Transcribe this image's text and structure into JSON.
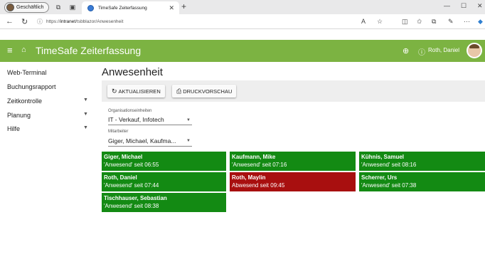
{
  "browser": {
    "profile_label": "Geschäftlich",
    "tab_title": "TimeSafe Zeiterfassung",
    "url_prefix": "https://",
    "url_host": "intranet",
    "url_path": "/tsbblazor/Anwesenheit"
  },
  "app": {
    "title": "TimeSafe Zeiterfassung",
    "user_name": "Roth, Daniel",
    "header_color": "#7cb342"
  },
  "sidebar": {
    "items": [
      {
        "label": "Web-Terminal",
        "has_children": false
      },
      {
        "label": "Buchungsrapport",
        "has_children": false
      },
      {
        "label": "Zeitkontrolle",
        "has_children": true
      },
      {
        "label": "Planung",
        "has_children": true
      },
      {
        "label": "Hilfe",
        "has_children": true
      }
    ]
  },
  "page": {
    "title": "Anwesenheit",
    "refresh_label": "AKTUALISIEREN",
    "print_label": "DRUCKVORSCHAU",
    "org_label": "Organisationseinheiten",
    "org_value": "IT - Verkauf, Infotech",
    "staff_label": "Mitarbeiter",
    "staff_value": "Giger, Michael, Kaufma..."
  },
  "colors": {
    "present": "#138a13",
    "absent": "#a80f0f"
  },
  "employees": [
    {
      "name": "Giger, Michael",
      "status": "'Anwesend' seit 06:55",
      "state": "present"
    },
    {
      "name": "Kaufmann, Mike",
      "status": "'Anwesend' seit 07:16",
      "state": "present"
    },
    {
      "name": "Kühnis, Samuel",
      "status": "'Anwesend' seit 08:16",
      "state": "present"
    },
    {
      "name": "Roth, Daniel",
      "status": "'Anwesend' seit 07:44",
      "state": "present"
    },
    {
      "name": "Roth, Maylin",
      "status": "Abwesend seit 09:45",
      "state": "absent"
    },
    {
      "name": "Scherrer, Urs",
      "status": "'Anwesend' seit 07:38",
      "state": "present"
    },
    {
      "name": "Tischhauser, Sebastian",
      "status": "'Anwesend' seit 08:38",
      "state": "present"
    }
  ]
}
